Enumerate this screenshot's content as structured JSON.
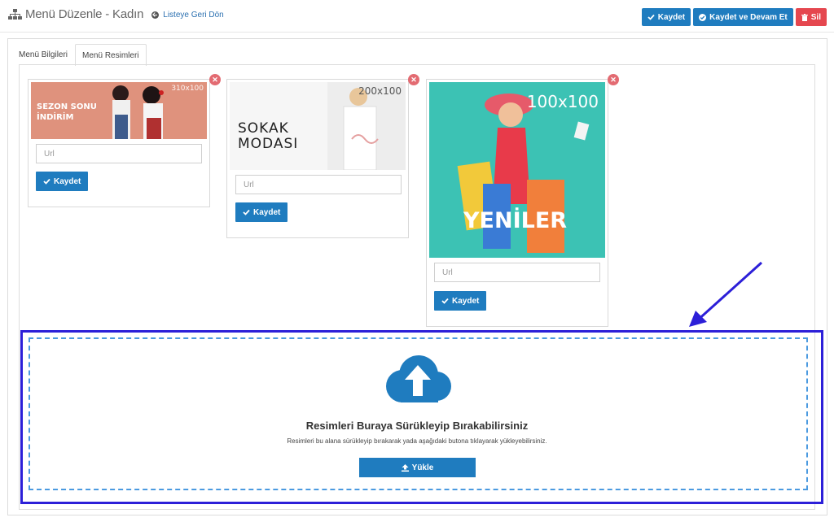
{
  "header": {
    "title": "Menü Düzenle - Kadın",
    "back_link": "Listeye Geri Dön",
    "actions": {
      "save": "Kaydet",
      "save_continue": "Kaydet ve Devam Et",
      "delete": "Sil"
    }
  },
  "tabs": [
    {
      "label": "Menü Bilgileri",
      "active": false
    },
    {
      "label": "Menü Resimleri",
      "active": true
    }
  ],
  "cards": [
    {
      "size_label": "310x100",
      "banner_text_line1": "SEZON SONU",
      "banner_text_line2": "İNDİRİM",
      "url_placeholder": "Url",
      "save_label": "Kaydet"
    },
    {
      "size_label": "200x100",
      "banner_text_line1": "SOKAK",
      "banner_text_line2": "MODASI",
      "url_placeholder": "Url",
      "save_label": "Kaydet"
    },
    {
      "size_label": "100x100",
      "banner_text_line1": "YENİLER",
      "url_placeholder": "Url",
      "save_label": "Kaydet"
    }
  ],
  "upload": {
    "title": "Resimleri Buraya Sürükleyip Bırakabilirsiniz",
    "subtitle": "Resimleri bu alana sürükleyip bırakarak yada aşağıdaki butona tıklayarak yükleyebilirsiniz.",
    "button_label": "Yükle"
  },
  "colors": {
    "primary": "#1f7cbf",
    "danger": "#e5474f",
    "highlight": "#2c1fd8",
    "dropzone_border": "#4b9ae0"
  },
  "icons": {
    "header": "sitemap-icon",
    "back": "arrow-circle-left-icon",
    "save": "check-icon",
    "save_continue": "check-circle-icon",
    "delete": "trash-icon",
    "remove": "close-icon",
    "upload_zone": "cloud-upload-icon",
    "upload_button": "upload-icon"
  }
}
